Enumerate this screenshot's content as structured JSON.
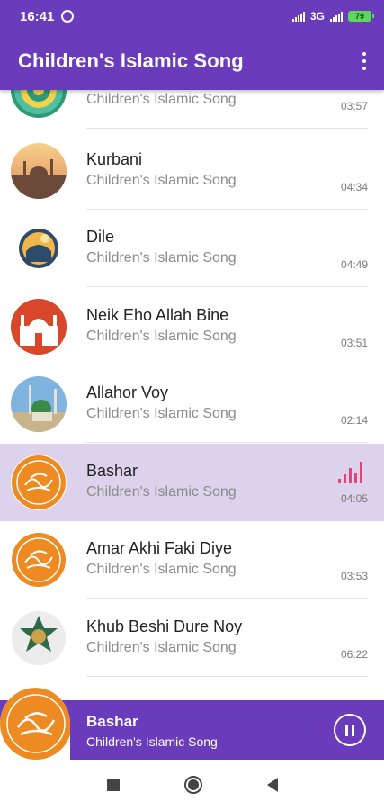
{
  "status_bar": {
    "time": "16:41",
    "network": "3G",
    "battery": "79",
    "icons": [
      "alarm-icon",
      "signal-icon",
      "battery-icon"
    ]
  },
  "app_bar": {
    "title": "Children's Islamic Song",
    "menu_icon": "more-vertical-icon"
  },
  "songs": [
    {
      "title": "",
      "subtitle": "Children's Islamic Song",
      "duration": "03:57",
      "thumb": "green-mandala"
    },
    {
      "title": "Kurbani",
      "subtitle": "Children's Islamic Song",
      "duration": "04:34",
      "thumb": "sunset-mosque"
    },
    {
      "title": "Dile",
      "subtitle": "Children's Islamic Song",
      "duration": "04:49",
      "thumb": "mosque-moon"
    },
    {
      "title": "Neik Eho Allah Bine",
      "subtitle": "Children's Islamic Song",
      "duration": "03:51",
      "thumb": "red-mosque"
    },
    {
      "title": "Allahor Voy",
      "subtitle": "Children's Islamic Song",
      "duration": "02:14",
      "thumb": "green-dome"
    },
    {
      "title": "Bashar",
      "subtitle": "Children's Islamic Song",
      "duration": "04:05",
      "thumb": "orange-calligraphy",
      "playing": true
    },
    {
      "title": "Amar Akhi Faki Diye",
      "subtitle": "Children's Islamic Song",
      "duration": "03:53",
      "thumb": "orange-calligraphy"
    },
    {
      "title": "Khub Beshi Dure Noy",
      "subtitle": "Children's Islamic Song",
      "duration": "06:22",
      "thumb": "green-star"
    }
  ],
  "now_playing": {
    "title": "Bashar",
    "subtitle": "Children's Islamic Song",
    "state_icon": "pause-icon"
  },
  "nav_bar": {
    "icons": [
      "recents-square-icon",
      "home-circle-icon",
      "back-triangle-icon"
    ]
  },
  "colors": {
    "primary": "#6a3cbc",
    "active_row": "#ddd2ec",
    "equalizer": "#e0457b"
  }
}
